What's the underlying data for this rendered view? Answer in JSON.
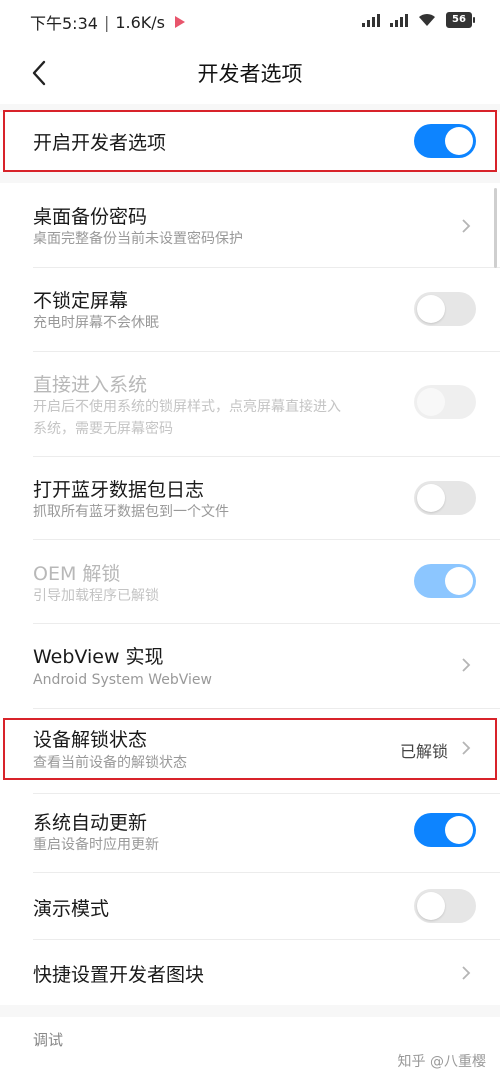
{
  "status_bar": {
    "time": "下午5:34",
    "separator": "|",
    "speed": "1.6K/s",
    "battery": "56"
  },
  "header": {
    "title": "开发者选项"
  },
  "developer_toggle": {
    "label": "开启开发者选项",
    "state": "on"
  },
  "settings": [
    {
      "title": "桌面备份密码",
      "subtitle": "桌面完整备份当前未设置密码保护",
      "control": "chevron"
    },
    {
      "title": "不锁定屏幕",
      "subtitle": "充电时屏幕不会休眠",
      "control": "toggle",
      "state": "off"
    },
    {
      "title": "直接进入系统",
      "subtitle": "开启后不使用系统的锁屏样式，点亮屏幕直接进入系统，需要无屏幕密码",
      "subtitle_line1": "开启后不使用系统的锁屏样式，点亮屏幕直接进入",
      "subtitle_line2": "系统，需要无屏幕密码",
      "control": "toggle",
      "state": "off",
      "disabled": true
    },
    {
      "title": "打开蓝牙数据包日志",
      "subtitle": "抓取所有蓝牙数据包到一个文件",
      "control": "toggle",
      "state": "off"
    },
    {
      "title": "OEM 解锁",
      "subtitle": "引导加载程序已解锁",
      "control": "toggle",
      "state": "on",
      "disabled": true
    },
    {
      "title": "WebView 实现",
      "subtitle": "Android System WebView",
      "control": "chevron"
    },
    {
      "title": "设备解锁状态",
      "subtitle": "查看当前设备的解锁状态",
      "control": "chevron",
      "value": "已解锁"
    },
    {
      "title": "系统自动更新",
      "subtitle": "重启设备时应用更新",
      "control": "toggle",
      "state": "on"
    },
    {
      "title": "演示模式",
      "control": "toggle",
      "state": "off"
    },
    {
      "title": "快捷设置开发者图块",
      "control": "chevron"
    }
  ],
  "debug_section": {
    "header": "调试"
  },
  "watermark": "知乎 @八重樱",
  "colors": {
    "accent": "#0d84ff",
    "highlight": "#d8232a"
  }
}
